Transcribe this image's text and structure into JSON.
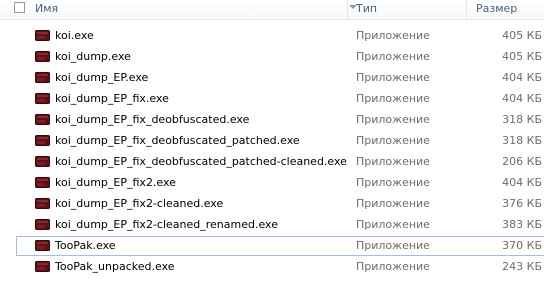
{
  "columns": {
    "name": "Имя",
    "type": "Тип",
    "size": "Размер"
  },
  "files": [
    {
      "name": "koi.exe",
      "type": "Приложение",
      "size": "405 КБ"
    },
    {
      "name": "koi_dump.exe",
      "type": "Приложение",
      "size": "405 КБ"
    },
    {
      "name": "koi_dump_EP.exe",
      "type": "Приложение",
      "size": "404 КБ"
    },
    {
      "name": "koi_dump_EP_fix.exe",
      "type": "Приложение",
      "size": "404 КБ"
    },
    {
      "name": "koi_dump_EP_fix_deobfuscated.exe",
      "type": "Приложение",
      "size": "318 КБ"
    },
    {
      "name": "koi_dump_EP_fix_deobfuscated_patched.exe",
      "type": "Приложение",
      "size": "318 КБ"
    },
    {
      "name": "koi_dump_EP_fix_deobfuscated_patched-cleaned.exe",
      "type": "Приложение",
      "size": "206 КБ"
    },
    {
      "name": "koi_dump_EP_fix2.exe",
      "type": "Приложение",
      "size": "404 КБ"
    },
    {
      "name": "koi_dump_EP_fix2-cleaned.exe",
      "type": "Приложение",
      "size": "376 КБ"
    },
    {
      "name": "koi_dump_EP_fix2-cleaned_renamed.exe",
      "type": "Приложение",
      "size": "383 КБ"
    },
    {
      "name": "TooPak.exe",
      "type": "Приложение",
      "size": "370 КБ"
    },
    {
      "name": "TooPak_unpacked.exe",
      "type": "Приложение",
      "size": "243 КБ"
    }
  ],
  "focused_index": 10,
  "icon": "exe-app-icon"
}
